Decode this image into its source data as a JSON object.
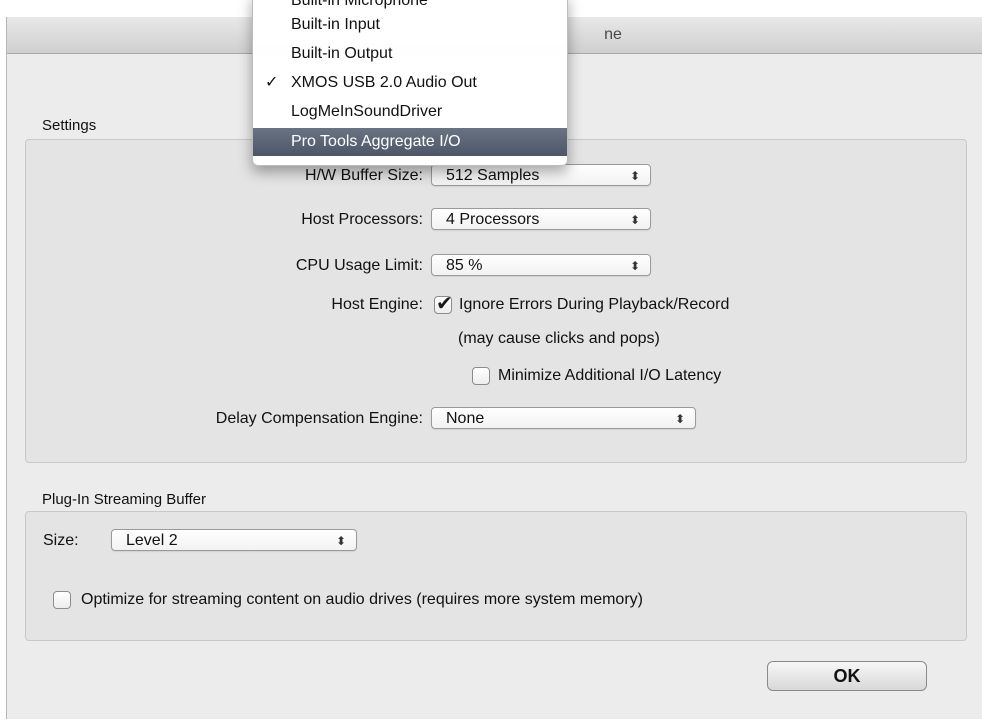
{
  "window": {
    "title_visible_fragment": "ne"
  },
  "device_menu": {
    "items": [
      {
        "label": "Built-in Microphone",
        "checked": false,
        "highlighted": false
      },
      {
        "label": "Built-in Input",
        "checked": false,
        "highlighted": false
      },
      {
        "label": "Built-in Output",
        "checked": false,
        "highlighted": false
      },
      {
        "label": "XMOS USB 2.0 Audio Out",
        "checked": true,
        "highlighted": false
      },
      {
        "label": "LogMeInSoundDriver",
        "checked": false,
        "highlighted": false
      },
      {
        "label": "Pro Tools Aggregate I/O",
        "checked": false,
        "highlighted": true
      }
    ],
    "check_glyph": "✓",
    "highlight_color": "#5a6273"
  },
  "settings": {
    "section_label": "Settings",
    "hw_buffer": {
      "label": "H/W Buffer Size:",
      "value": "512 Samples"
    },
    "host_processors": {
      "label": "Host Processors:",
      "value": "4 Processors"
    },
    "cpu_limit": {
      "label": "CPU Usage Limit:",
      "value": "85 %"
    },
    "host_engine": {
      "label": "Host Engine:",
      "ignore_errors": {
        "label": "Ignore Errors During Playback/Record",
        "checked": true
      },
      "note": "(may cause clicks and pops)",
      "minimize_latency": {
        "label": "Minimize Additional I/O Latency",
        "checked": false
      }
    },
    "delay_comp": {
      "label": "Delay Compensation Engine:",
      "value": "None"
    }
  },
  "streaming": {
    "section_label": "Plug-In Streaming Buffer",
    "size": {
      "label": "Size:",
      "value": "Level 2"
    },
    "optimize": {
      "label": "Optimize for streaming content on audio drives (requires more system memory)",
      "checked": false
    }
  },
  "ok_label": "OK",
  "icons": {
    "popup_arrows": "⌃⌄",
    "checkmark": "✔"
  }
}
